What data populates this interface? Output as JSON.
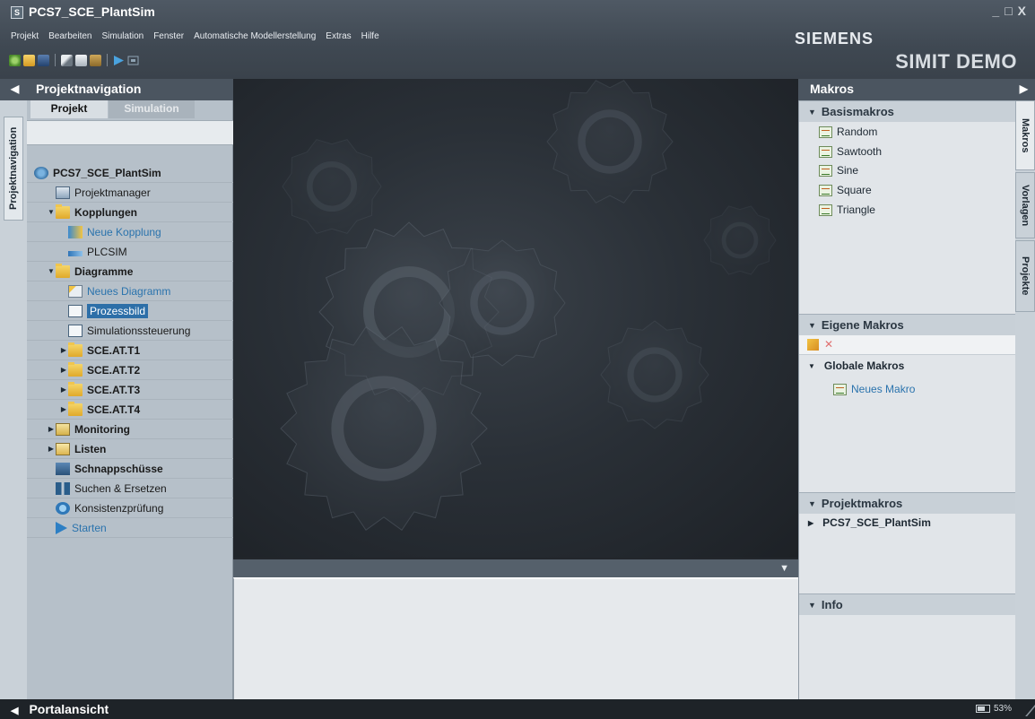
{
  "window": {
    "title": "PCS7_SCE_PlantSim",
    "minimize": "_",
    "maximize": "□",
    "close": "X"
  },
  "menu": [
    "Projekt",
    "Bearbeiten",
    "Simulation",
    "Fenster",
    "Automatische Modellerstellung",
    "Extras",
    "Hilfe"
  ],
  "branding": {
    "logo": "SIEMENS",
    "product": "SIMIT DEMO"
  },
  "toolbar_icons": [
    "new-project-icon",
    "open-folder-icon",
    "save-icon",
    "cut-icon",
    "copy-icon",
    "paste-icon",
    "start-simulation-icon",
    "stop-simulation-icon"
  ],
  "left": {
    "header": "Projektnavigation",
    "vertical_tab": "Projektnavigation",
    "tabs": [
      "Projekt",
      "Simulation"
    ],
    "tree": [
      {
        "label": "PCS7_SCE_PlantSim",
        "level": 0,
        "icon": "project-icon",
        "bold": true
      },
      {
        "label": "Projektmanager",
        "level": 1,
        "icon": "project-manager-icon"
      },
      {
        "label": "Kopplungen",
        "level": 1,
        "icon": "folder-icon",
        "bold": true,
        "expand": "open"
      },
      {
        "label": "Neue Kopplung",
        "level": 2,
        "icon": "new-coupling-icon",
        "link": true
      },
      {
        "label": "PLCSIM",
        "level": 2,
        "icon": "plcsim-icon"
      },
      {
        "label": "Diagramme",
        "level": 1,
        "icon": "folder-icon",
        "bold": true,
        "expand": "open"
      },
      {
        "label": "Neues Diagramm",
        "level": 2,
        "icon": "new-diagram-icon",
        "link": true
      },
      {
        "label": "Prozessbild",
        "level": 2,
        "icon": "diagram-icon",
        "selected": true
      },
      {
        "label": "Simulationssteuerung",
        "level": 2,
        "icon": "diagram-icon"
      },
      {
        "label": "SCE.AT.T1",
        "level": 2,
        "icon": "folder-icon",
        "bold": true,
        "expand": "closed"
      },
      {
        "label": "SCE.AT.T2",
        "level": 2,
        "icon": "folder-icon",
        "bold": true,
        "expand": "closed"
      },
      {
        "label": "SCE.AT.T3",
        "level": 2,
        "icon": "folder-icon",
        "bold": true,
        "expand": "closed"
      },
      {
        "label": "SCE.AT.T4",
        "level": 2,
        "icon": "folder-icon",
        "bold": true,
        "expand": "closed"
      },
      {
        "label": "Monitoring",
        "level": 1,
        "icon": "monitoring-icon",
        "bold": true,
        "expand": "closed"
      },
      {
        "label": "Listen",
        "level": 1,
        "icon": "list-icon",
        "bold": true,
        "expand": "closed"
      },
      {
        "label": "Schnappschüsse",
        "level": 1,
        "icon": "snapshot-icon",
        "bold": true
      },
      {
        "label": "Suchen & Ersetzen",
        "level": 1,
        "icon": "binoculars-icon"
      },
      {
        "label": "Konsistenzprüfung",
        "level": 1,
        "icon": "consistency-check-icon"
      },
      {
        "label": "Starten",
        "level": 1,
        "icon": "play-icon",
        "link": true
      }
    ]
  },
  "right": {
    "header": "Makros",
    "vertical_tabs": [
      "Makros",
      "Vorlagen",
      "Projekte"
    ],
    "sections": {
      "basis": {
        "title": "Basismakros",
        "items": [
          "Random",
          "Sawtooth",
          "Sine",
          "Square",
          "Triangle"
        ]
      },
      "eigene": {
        "title": "Eigene Makros",
        "group": "Globale Makros",
        "items": [
          "Neues Makro"
        ]
      },
      "projekt": {
        "title": "Projektmakros",
        "items": [
          "PCS7_SCE_PlantSim"
        ]
      },
      "info": {
        "title": "Info"
      }
    }
  },
  "status": {
    "portal": "Portalansicht",
    "zoom": "53%"
  }
}
